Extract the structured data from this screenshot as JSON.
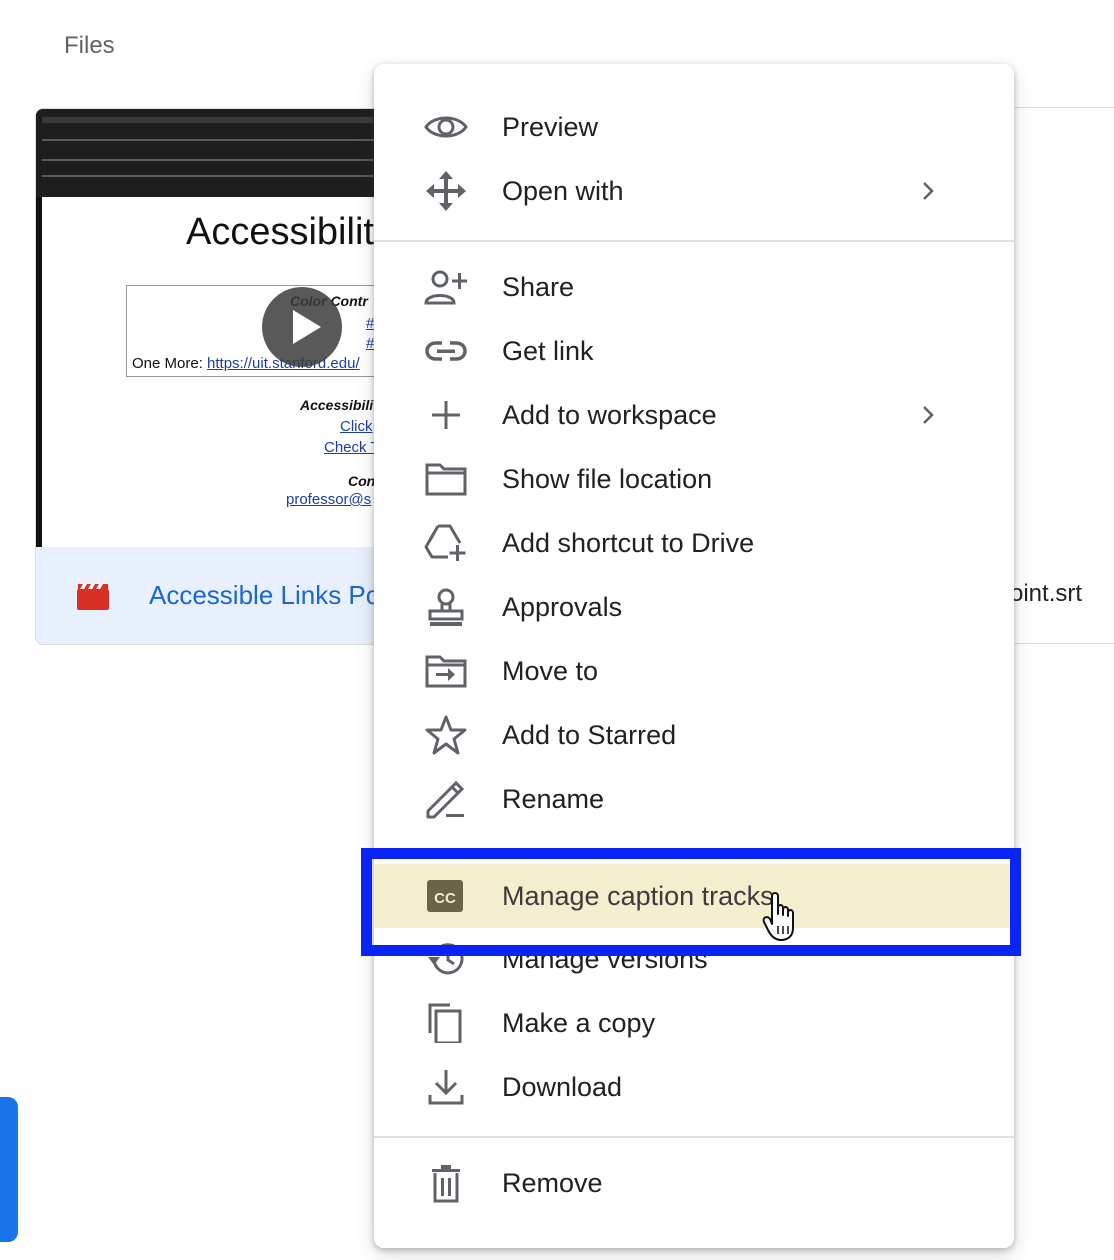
{
  "page": {
    "section_label": "Files"
  },
  "file_card": {
    "name": "Accessible Links Po",
    "slide": {
      "title": "Accessibility",
      "lines": [
        "Color Contr",
        "#",
        "#",
        "One More: ",
        "https://uit.stanford.edu/",
        "Accessibilit",
        "Click",
        "Check T",
        "Con",
        "professor@s"
      ]
    }
  },
  "other_file": {
    "name": "oint.srt"
  },
  "menu": {
    "items": [
      {
        "label": "Preview",
        "icon": "eye-icon"
      },
      {
        "label": "Open with",
        "icon": "move-arrows-icon",
        "submenu": true
      },
      {
        "label": "Share",
        "icon": "person-add-icon"
      },
      {
        "label": "Get link",
        "icon": "link-icon"
      },
      {
        "label": "Add to workspace",
        "icon": "plus-icon",
        "submenu": true
      },
      {
        "label": "Show file location",
        "icon": "folder-icon"
      },
      {
        "label": "Add shortcut to Drive",
        "icon": "drive-add-icon"
      },
      {
        "label": "Approvals",
        "icon": "stamp-icon"
      },
      {
        "label": "Move to",
        "icon": "folder-move-icon"
      },
      {
        "label": "Add to Starred",
        "icon": "star-icon"
      },
      {
        "label": "Rename",
        "icon": "pencil-icon"
      },
      {
        "label": "Manage caption tracks",
        "icon": "closed-caption-icon",
        "cc_text": "CC",
        "highlighted": true
      },
      {
        "label": "Manage versions",
        "icon": "history-icon"
      },
      {
        "label": "Make a copy",
        "icon": "copy-icon"
      },
      {
        "label": "Download",
        "icon": "download-icon"
      },
      {
        "label": "Remove",
        "icon": "trash-icon"
      }
    ]
  },
  "colors": {
    "annotation_border": "#0a24f5",
    "highlight_fill": "#f3eece",
    "file_name_link": "#1967d2",
    "video_icon": "#d93025"
  }
}
